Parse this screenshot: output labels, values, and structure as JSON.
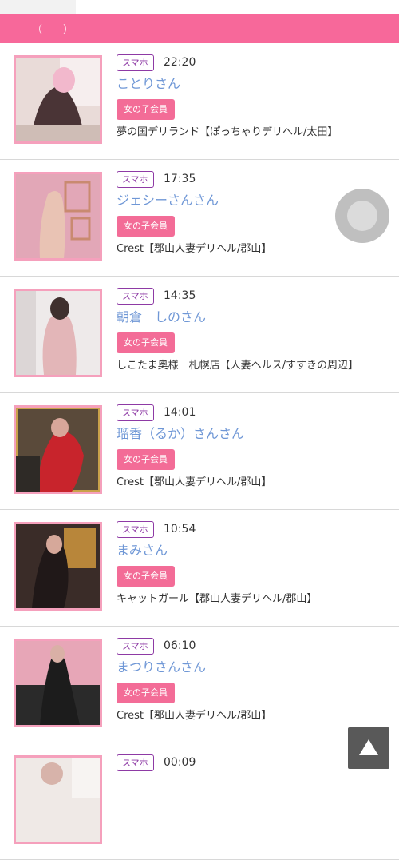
{
  "header": {
    "text": "（＿＿）"
  },
  "items": [
    {
      "badge": "スマホ",
      "time": "22:20",
      "name": "ことりさん",
      "member": "女の子会員",
      "shop": "夢の国デリランド【ぽっちゃりデリヘル/太田】"
    },
    {
      "badge": "スマホ",
      "time": "17:35",
      "name": "ジェシーさんさん",
      "member": "女の子会員",
      "shop": "Crest【郡山人妻デリヘル/郡山】"
    },
    {
      "badge": "スマホ",
      "time": "14:35",
      "name": "朝倉　しのさん",
      "member": "女の子会員",
      "shop": "しこたま奥様　札幌店【人妻ヘルス/すすきの周辺】"
    },
    {
      "badge": "スマホ",
      "time": "14:01",
      "name": "瑠香（るか）さんさん",
      "member": "女の子会員",
      "shop": "Crest【郡山人妻デリヘル/郡山】"
    },
    {
      "badge": "スマホ",
      "time": "10:54",
      "name": "まみさん",
      "member": "女の子会員",
      "shop": "キャットガール【郡山人妻デリヘル/郡山】"
    },
    {
      "badge": "スマホ",
      "time": "06:10",
      "name": "まつりさんさん",
      "member": "女の子会員",
      "shop": "Crest【郡山人妻デリヘル/郡山】"
    },
    {
      "badge": "スマホ",
      "time": "00:09"
    }
  ],
  "colors": {
    "header": "#f7689a",
    "badge_border": "#8e3aa5",
    "name": "#6f97d6",
    "member_bg": "#f36c97"
  },
  "icons": {
    "scroll_top": "triangle-up-icon",
    "floating": "circle-button"
  }
}
